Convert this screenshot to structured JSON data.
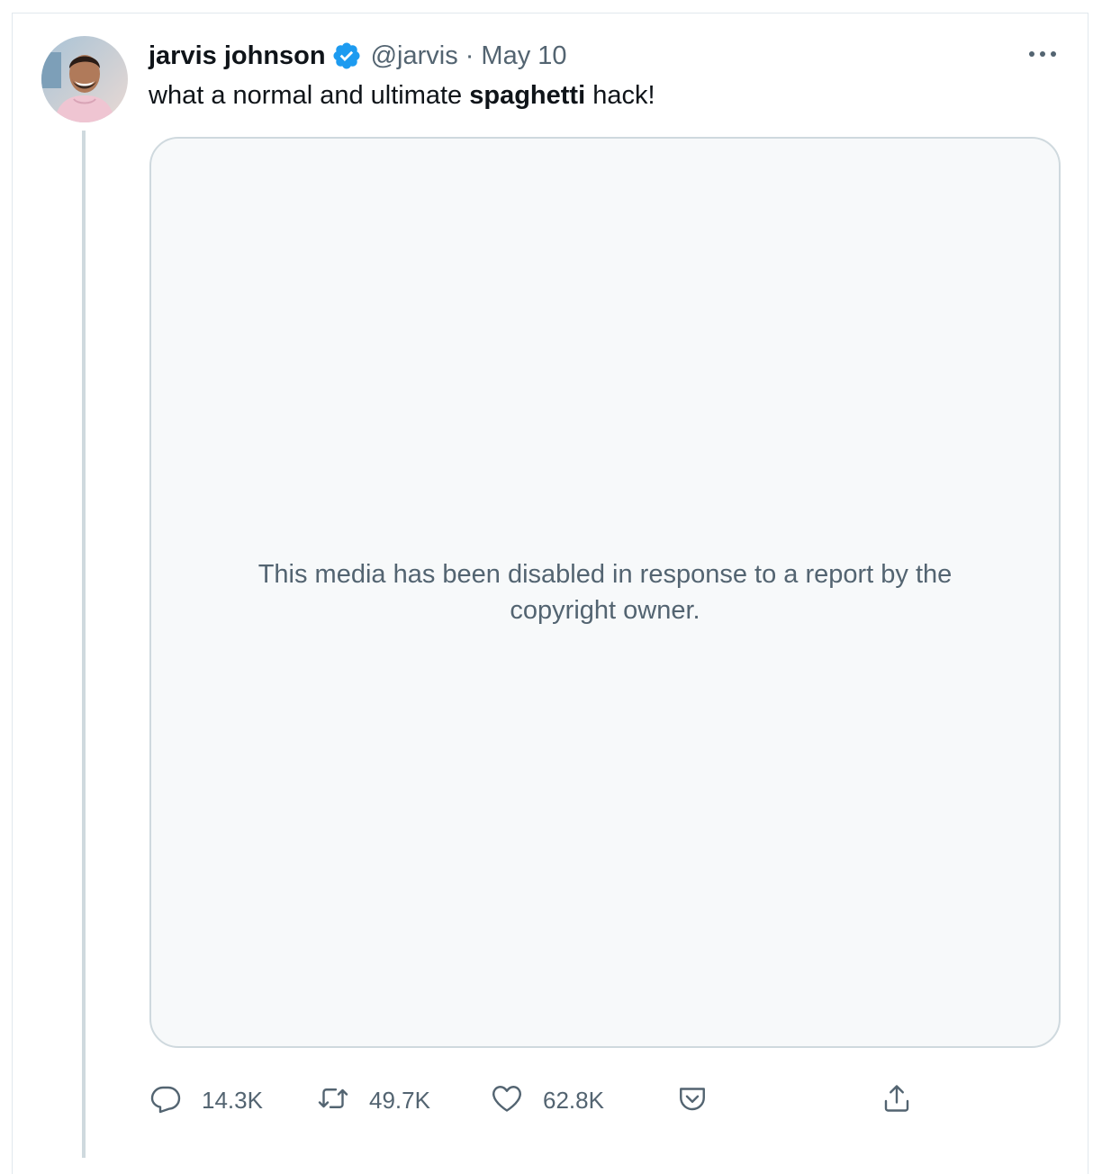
{
  "tweet": {
    "author_name": "jarvis johnson",
    "handle": "@jarvis",
    "separator": "·",
    "date": "May 10",
    "text_before": "what a normal and ultimate ",
    "text_bold": "spaghetti",
    "text_after": " hack!",
    "media_message": "This media has been disabled in response to a report by the copyright owner."
  },
  "actions": {
    "replies": "14.3K",
    "retweets": "49.7K",
    "likes": "62.8K"
  },
  "icons": {
    "verified": "verified-badge-icon",
    "more": "more-options-icon",
    "reply": "reply-icon",
    "retweet": "retweet-icon",
    "like": "heart-icon",
    "save": "pocket-icon",
    "share": "share-icon"
  },
  "colors": {
    "verified": "#1d9bf0",
    "secondary_text": "#536471",
    "primary_text": "#0f1419",
    "media_bg": "#f7f9fa",
    "border": "#cfd9de"
  }
}
